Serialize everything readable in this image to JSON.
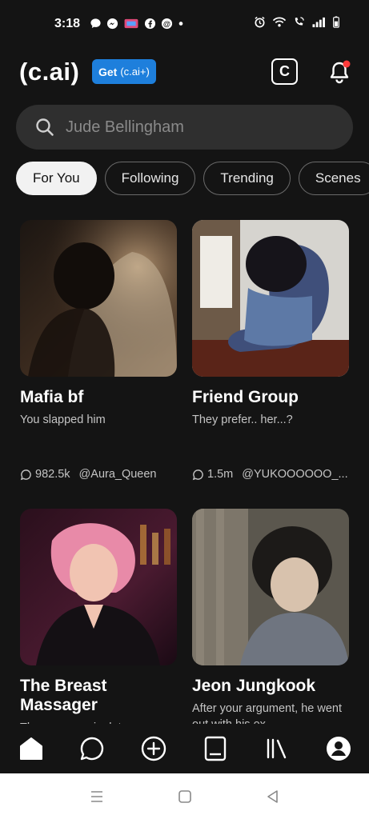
{
  "status_bar": {
    "time": "3:18",
    "left_icons": [
      "chat-bubble-icon",
      "messenger-icon",
      "app-icon",
      "facebook-icon",
      "threads-icon",
      "dot-icon"
    ],
    "right_icons": [
      "alarm-icon",
      "wifi-icon",
      "wifi-call-icon",
      "signal-icon",
      "battery-icon"
    ]
  },
  "header": {
    "logo": "(c.ai)",
    "get_label": "Get",
    "get_sub": "(c.ai+)",
    "c_button_label": "C",
    "notification_dot_color": "#ff3b3b"
  },
  "search": {
    "placeholder": "Jude Bellingham"
  },
  "tabs": [
    {
      "label": "For You",
      "active": true
    },
    {
      "label": "Following",
      "active": false
    },
    {
      "label": "Trending",
      "active": false
    },
    {
      "label": "Scenes",
      "active": false
    }
  ],
  "cards": [
    {
      "title": "Mafia bf",
      "description": "You slapped him",
      "chats": "982.5k",
      "author": "@Aura_Queen"
    },
    {
      "title": "Friend Group",
      "description": "They prefer.. her...?",
      "chats": "1.5m",
      "author": "@YUKOOOOOO_..."
    },
    {
      "title": "The Breast Massager",
      "description": "They can manipulate your ...",
      "chats": "",
      "author": ""
    },
    {
      "title": "Jeon Jungkook",
      "description": "After your argument, he went out with his ex",
      "chats": "",
      "author": ""
    }
  ],
  "bottom_nav": [
    "home-icon",
    "chat-icon",
    "create-icon",
    "feed-icon",
    "library-icon",
    "profile-icon"
  ],
  "colors": {
    "background": "#141414",
    "accent": "#1e7fdc",
    "search_bg": "#2f2f2f"
  }
}
